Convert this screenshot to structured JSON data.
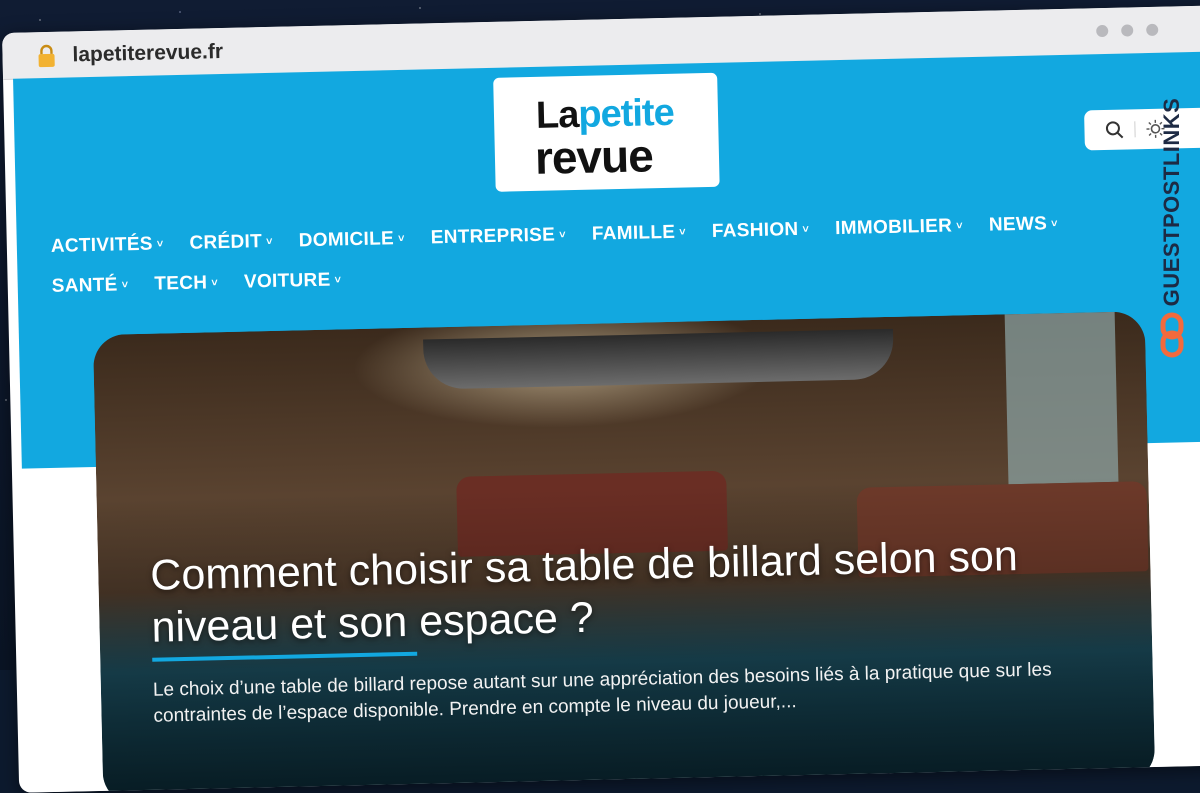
{
  "browser": {
    "url": "lapetiterevue.fr",
    "lock_icon": "lock-icon"
  },
  "site": {
    "logo": {
      "line1_a": "La",
      "line1_b": "petite",
      "line2": "revue"
    },
    "tools": {
      "search_icon": "search-icon",
      "theme_icon": "sun-icon"
    },
    "nav": {
      "row1": [
        {
          "label": "ACTIVITÉS"
        },
        {
          "label": "CRÉDIT"
        },
        {
          "label": "DOMICILE"
        },
        {
          "label": "ENTREPRISE"
        },
        {
          "label": "FAMILLE"
        },
        {
          "label": "FASHION"
        },
        {
          "label": "IMMOBILIER"
        },
        {
          "label": "NEWS"
        }
      ],
      "row2": [
        {
          "label": "SANTÉ"
        },
        {
          "label": "TECH"
        },
        {
          "label": "VOITURE"
        }
      ],
      "chevron": "˅"
    },
    "featured": {
      "title": "Comment choisir sa table de billard selon son niveau et son espace ?",
      "excerpt": "Le choix d’une table de billard repose autant sur une appréciation des besoins liés à la pratique que sur les contraintes de l’espace disponible. Prendre en compte le niveau du joueur,..."
    }
  },
  "badge": {
    "text": "GUESTPOSTLINKS",
    "icon": "link-icon"
  },
  "colors": {
    "brand": "#12a8e0",
    "badge_text": "#1d2a44",
    "badge_icon": "#f26a3d"
  }
}
